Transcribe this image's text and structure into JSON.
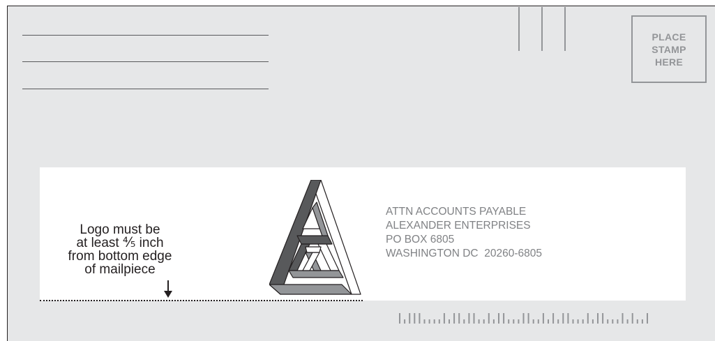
{
  "stamp": {
    "lines": [
      "PLACE",
      "STAMP",
      "HERE"
    ]
  },
  "clearance_note": {
    "lines": [
      "Logo must be",
      "at least ⅘ inch",
      "from bottom edge",
      "of mailpiece"
    ]
  },
  "address": {
    "lines": [
      "ATTN ACCOUNTS PAYABLE",
      "ALEXANDER ENTERPRISES",
      "PO BOX 6805",
      "WASHINGTON DC  20260-6805"
    ]
  },
  "barcode": {
    "pattern": "FAFFFAAAAFAFFAFFAAFAFFAAAFFAAFAFAFFAAAFAFFAAAFAFAAF"
  },
  "colors": {
    "background": "#e6e7e8",
    "clear_zone": "#ffffff",
    "stamp_border": "#939598",
    "address_text": "#808285",
    "logo_dark": "#58595b",
    "logo_mid": "#939598",
    "outline": "#231f20"
  },
  "icons": {
    "logo": "impossible-triangle-logo",
    "arrow": "down-arrow-icon"
  }
}
